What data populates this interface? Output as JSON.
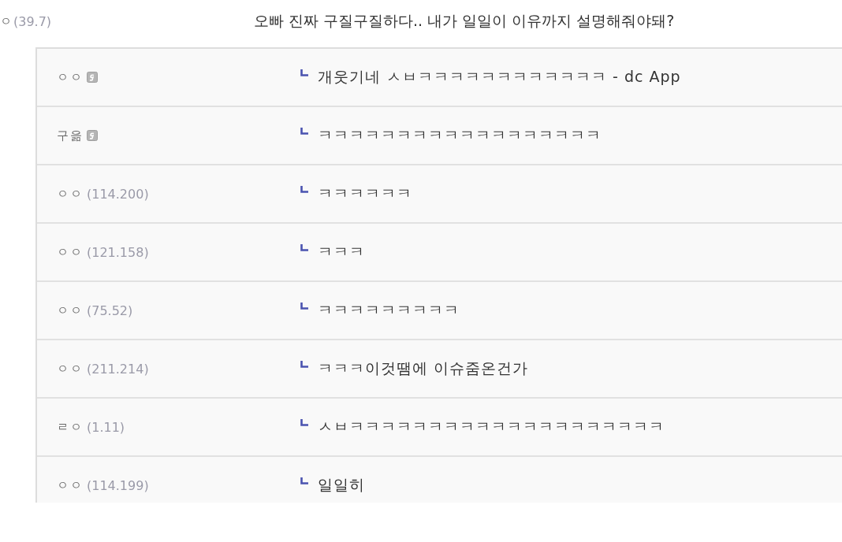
{
  "comment": {
    "nick": "ㅇ",
    "ip": "(39.7)",
    "text": "오빠 진짜 구질구질하다.. 내가 일일이 이유까지 설명해줘야돼?"
  },
  "replies": [
    {
      "kind": "member",
      "nick": "ㅇㅇ",
      "text": "개웃기네 ㅅㅂㅋㅋㅋㅋㅋㅋㅋㅋㅋㅋㅋㅋ - dc App"
    },
    {
      "kind": "member",
      "nick": "구읆",
      "text": "ㅋㅋㅋㅋㅋㅋㅋㅋㅋㅋㅋㅋㅋㅋㅋㅋㅋㅋ"
    },
    {
      "kind": "guest",
      "nick": "ㅇㅇ",
      "ip": "(114.200)",
      "text": "ㅋㅋㅋㅋㅋㅋ"
    },
    {
      "kind": "guest",
      "nick": "ㅇㅇ",
      "ip": "(121.158)",
      "text": "ㅋㅋㅋ"
    },
    {
      "kind": "guest",
      "nick": "ㅇㅇ",
      "ip": "(75.52)",
      "text": "ㅋㅋㅋㅋㅋㅋㅋㅋㅋ"
    },
    {
      "kind": "guest",
      "nick": "ㅇㅇ",
      "ip": "(211.214)",
      "text": "ㅋㅋㅋ이것땜에 이슈줌온건가"
    },
    {
      "kind": "guest",
      "nick": "ㄹㅇ",
      "ip": "(1.11)",
      "text": "ㅅㅂㅋㅋㅋㅋㅋㅋㅋㅋㅋㅋㅋㅋㅋㅋㅋㅋㅋㅋㅋㅋ"
    },
    {
      "kind": "guest",
      "nick": "ㅇㅇ",
      "ip": "(114.199)",
      "text": "일일히"
    }
  ]
}
